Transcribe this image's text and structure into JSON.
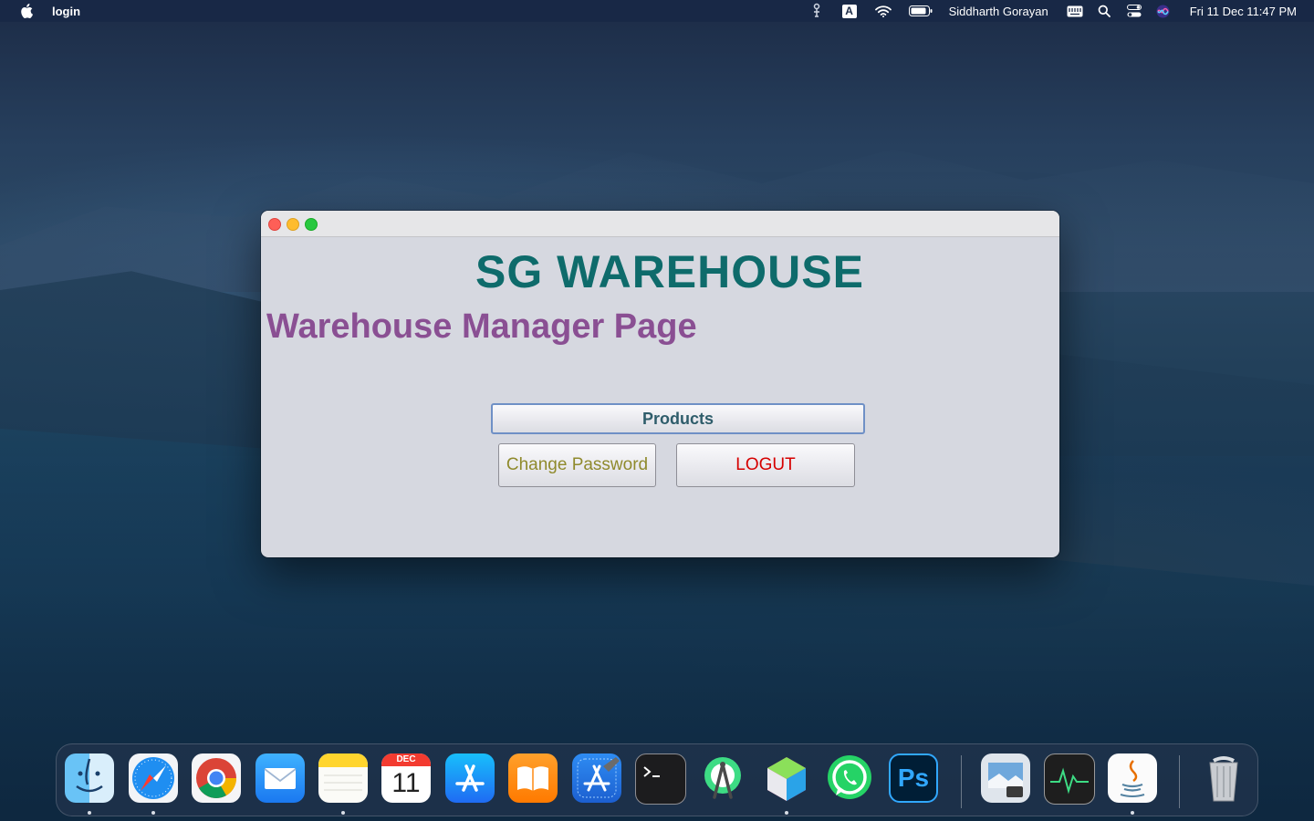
{
  "menubar": {
    "app_name": "login",
    "user_name": "Siddharth Gorayan",
    "datetime": "Fri 11 Dec  11:47 PM",
    "input_source_letter": "A",
    "icons": [
      "apple-icon",
      "script-editor-icon",
      "input-source-icon",
      "wifi-icon",
      "battery-icon",
      "keyboard-icon",
      "spotlight-search-icon",
      "control-center-icon",
      "siri-icon"
    ]
  },
  "window": {
    "title": "SG WAREHOUSE",
    "subtitle": "Warehouse Manager Page",
    "buttons": {
      "products": "Products",
      "change_password": "Change Password",
      "logout": "LOGUT"
    }
  },
  "dock": {
    "calendar_month": "DEC",
    "calendar_day": "11",
    "photoshop_label": "Ps",
    "apps": [
      "finder",
      "safari",
      "chrome",
      "mail",
      "notes",
      "calendar",
      "app-store",
      "books",
      "xcode",
      "terminal",
      "android-studio",
      "netbeans",
      "whatsapp",
      "photoshop",
      "preview",
      "activity-monitor",
      "java",
      "trash"
    ]
  },
  "colors": {
    "title": "#0e6b6b",
    "subtitle": "#8a4f93",
    "products_text": "#2f5d6b",
    "change_password_text": "#8f8a2c",
    "logout_text": "#d60000",
    "window_bg": "#d6d8e0"
  }
}
